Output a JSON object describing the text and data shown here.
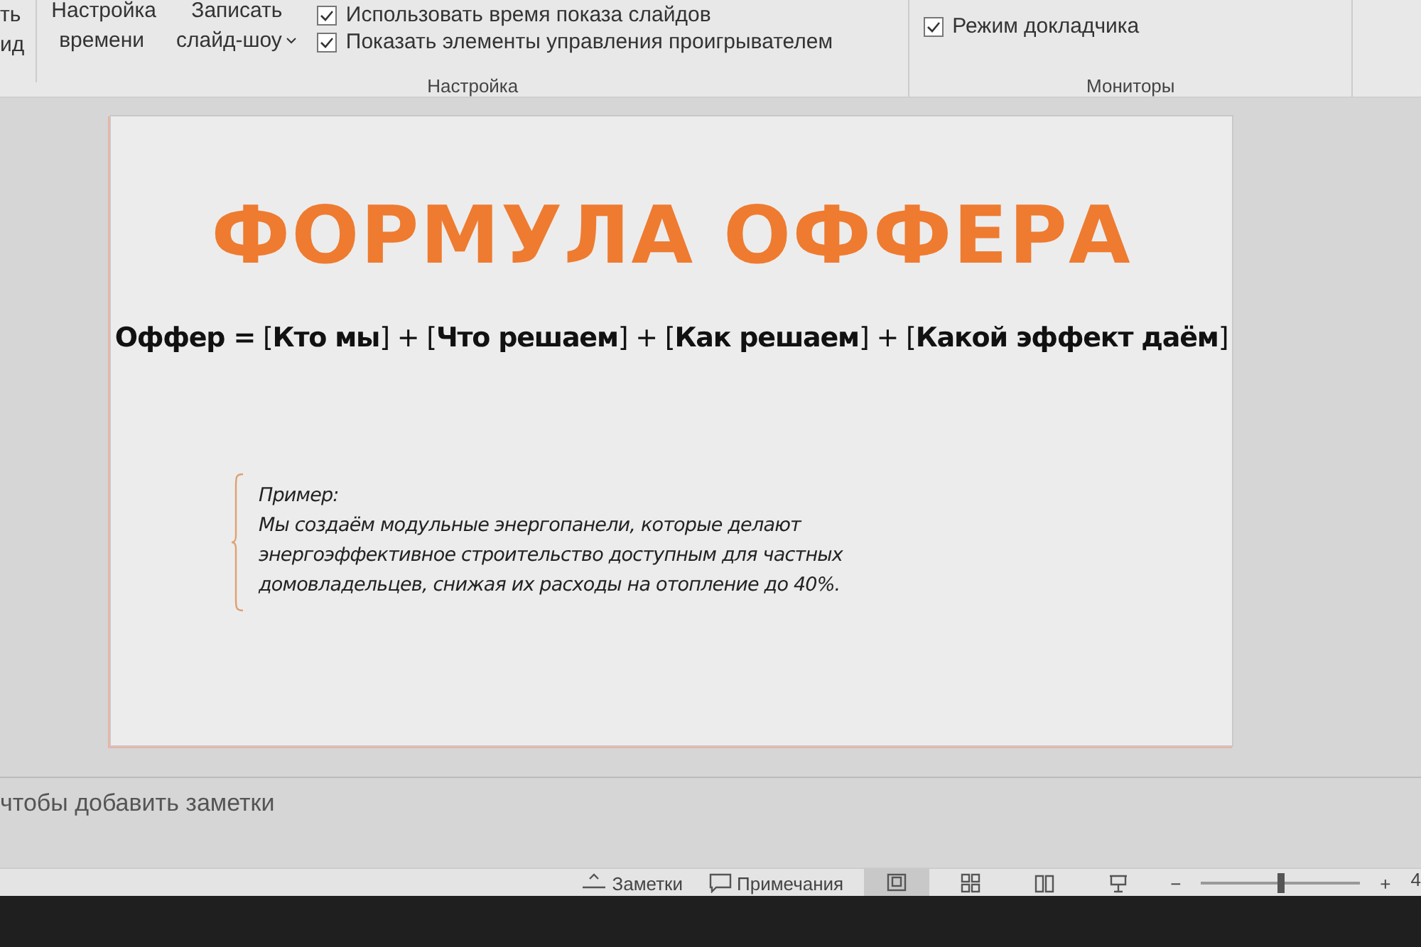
{
  "ribbon": {
    "left_cut": [
      "ть",
      "ид"
    ],
    "buttons": [
      {
        "lines": [
          "Настройка",
          "времени"
        ],
        "dropdown": false
      },
      {
        "lines": [
          "Записать",
          "слайд-шоу"
        ],
        "dropdown": true
      }
    ],
    "checkboxes": [
      {
        "label": "Использовать время показа слайдов",
        "checked": true
      },
      {
        "label": "Показать элементы управления проигрывателем",
        "checked": true
      }
    ],
    "groups": [
      {
        "label": "Настройка"
      },
      {
        "label": "Мониторы"
      }
    ],
    "monitor_checkboxes": [
      {
        "label": "Режим докладчика",
        "checked": true
      }
    ]
  },
  "slide": {
    "title": "ФОРМУЛА ОФФЕРА",
    "formula": "**Оффер =** [**Кто мы**] + [**Что решаем**] + [**Как решаем**] + [**Какой эффект даём**]",
    "example_label": "Пример:",
    "example_text": "Мы создаём модульные энергопанели, которые делают энергоэффективное строительство доступным для частных домовладельцев, снижая их расходы на отопление до 40%."
  },
  "notes": {
    "placeholder": "чтобы добавить заметки"
  },
  "status_bar": {
    "notes_button": "Заметки",
    "comments_button": "Примечания",
    "views": [
      {
        "kind": "normal",
        "selected": true
      },
      {
        "kind": "sorter",
        "selected": false
      },
      {
        "kind": "reading",
        "selected": false
      },
      {
        "kind": "show",
        "selected": false
      }
    ],
    "zoom": {
      "minus": "−",
      "plus": "+",
      "level": 0.5,
      "value_cut": "4"
    }
  }
}
